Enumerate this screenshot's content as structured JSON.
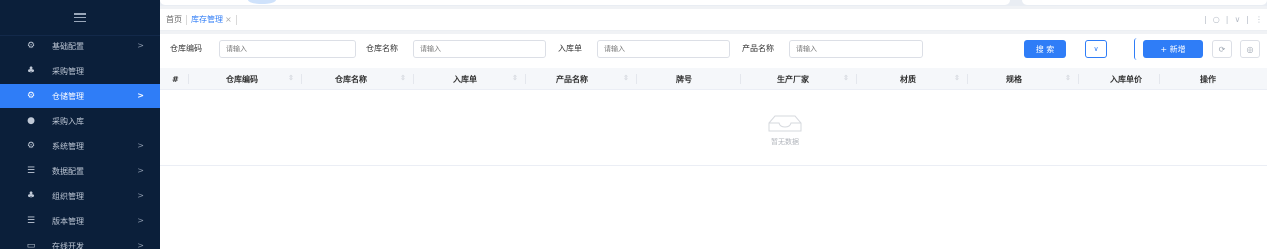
{
  "sidebar": {
    "items": [
      {
        "label": "基础配置",
        "icon": "gear-icon",
        "glyph": "⚙",
        "active": false,
        "arrow": ">"
      },
      {
        "label": "采购管理",
        "icon": "org-tree-icon",
        "glyph": "♣",
        "active": false,
        "arrow": ""
      },
      {
        "label": "仓储管理",
        "icon": "gear-icon",
        "glyph": "⚙",
        "active": true,
        "arrow": ">"
      },
      {
        "label": "采购入库",
        "icon": "user-circle-icon",
        "glyph": "●",
        "active": false,
        "arrow": ""
      },
      {
        "label": "系统管理",
        "icon": "gear-icon",
        "glyph": "⚙",
        "active": false,
        "arrow": ">"
      },
      {
        "label": "数据配置",
        "icon": "list-icon",
        "glyph": "☰",
        "active": false,
        "arrow": ">"
      },
      {
        "label": "组织管理",
        "icon": "org-tree-icon",
        "glyph": "♣",
        "active": false,
        "arrow": ">"
      },
      {
        "label": "版本管理",
        "icon": "menu-icon",
        "glyph": "☰",
        "active": false,
        "arrow": ">"
      },
      {
        "label": "在线开发",
        "icon": "monitor-icon",
        "glyph": "▭",
        "active": false,
        "arrow": ">"
      }
    ]
  },
  "tabs": {
    "home": "首页",
    "current": "库存管理",
    "close": "×"
  },
  "search": {
    "fields": [
      {
        "label": "仓库编码",
        "placeholder": "请输入"
      },
      {
        "label": "仓库名称",
        "placeholder": "请输入"
      },
      {
        "label": "入库单",
        "placeholder": "请输入"
      },
      {
        "label": "产品名称",
        "placeholder": "请输入"
      }
    ],
    "search_label": "搜 索",
    "add_label": "+ 新增"
  },
  "table": {
    "columns": [
      "#",
      "仓库编码",
      "仓库名称",
      "入库单",
      "产品名称",
      "牌号",
      "生产厂家",
      "材质",
      "规格",
      "入库单价",
      "操作"
    ],
    "empty_text": "暂无数据"
  },
  "colors": {
    "sidebar_bg": "#0b1f3a",
    "accent": "#2f7df7"
  }
}
